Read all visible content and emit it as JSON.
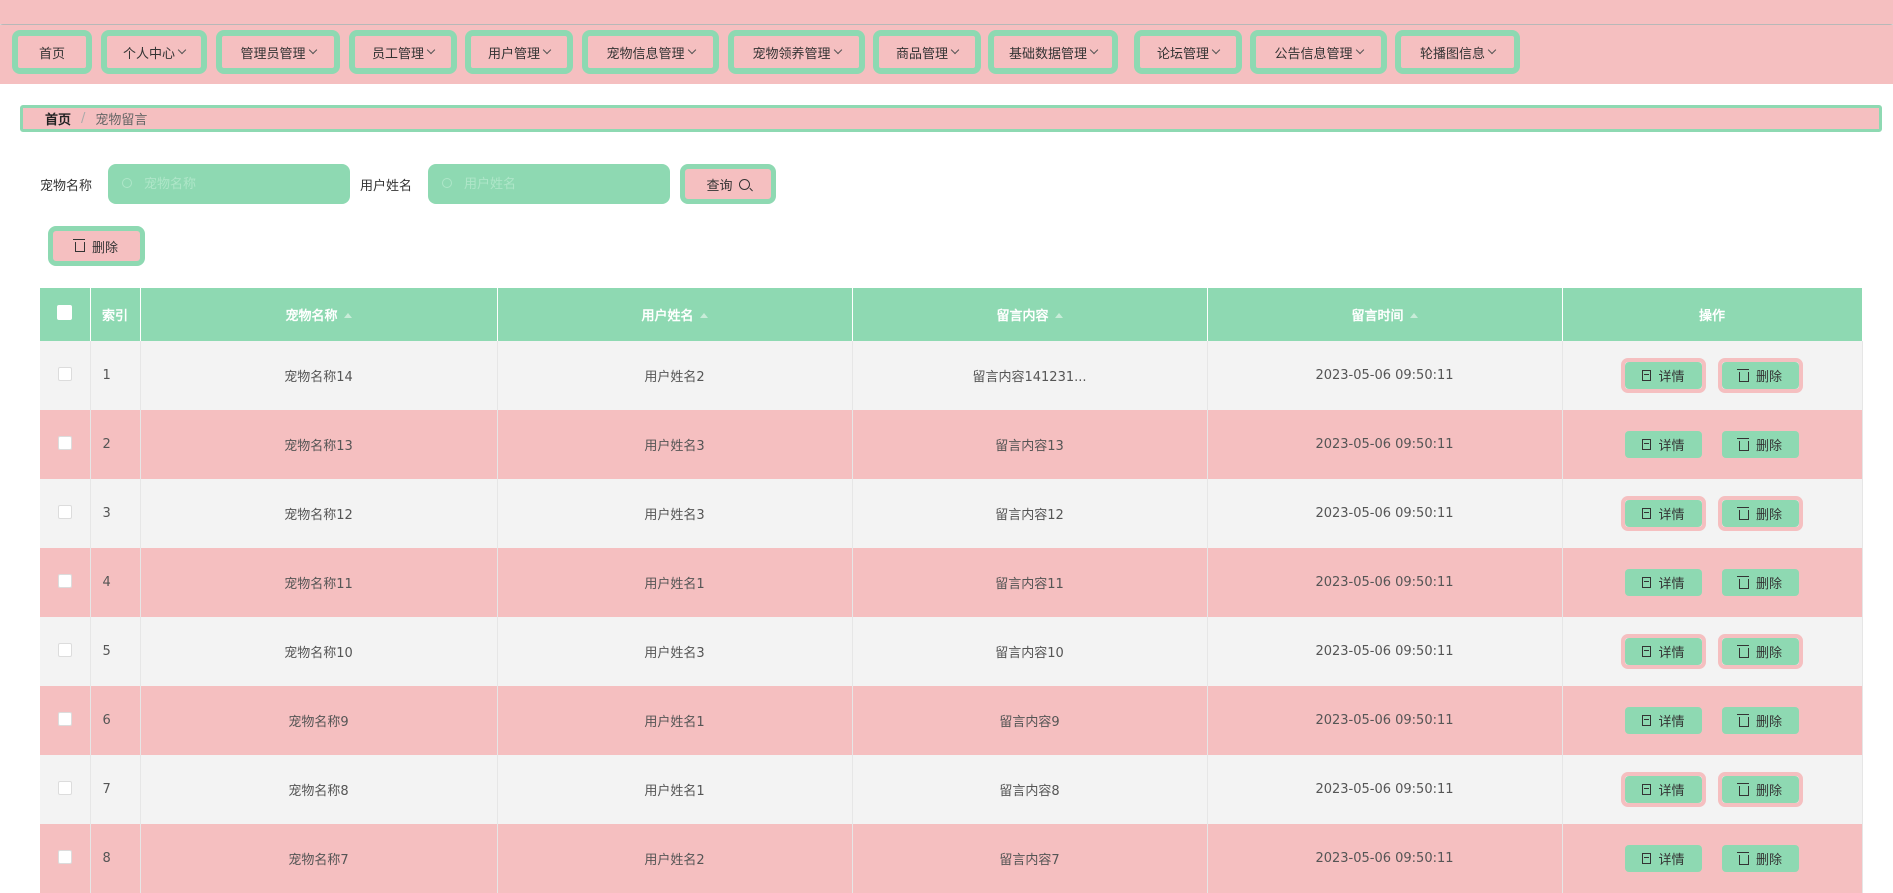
{
  "nav": {
    "menus": [
      {
        "label": "首页",
        "dropdown": false
      },
      {
        "label": "个人中心",
        "dropdown": true
      },
      {
        "label": "管理员管理",
        "dropdown": true
      },
      {
        "label": "员工管理",
        "dropdown": true
      },
      {
        "label": "用户管理",
        "dropdown": true
      },
      {
        "label": "宠物信息管理",
        "dropdown": true
      },
      {
        "label": "宠物领养管理",
        "dropdown": true
      },
      {
        "label": "商品管理",
        "dropdown": true
      },
      {
        "label": "基础数据管理",
        "dropdown": true
      },
      {
        "label": "论坛管理",
        "dropdown": true
      },
      {
        "label": "公告信息管理",
        "dropdown": true
      },
      {
        "label": "轮播图信息",
        "dropdown": true
      }
    ]
  },
  "breadcrumb": {
    "home": "首页",
    "separator": "/",
    "current": "宠物留言"
  },
  "search": {
    "pet_name_label": "宠物名称",
    "pet_name_placeholder": "宠物名称",
    "user_name_label": "用户姓名",
    "user_name_placeholder": "用户姓名",
    "query_label": "查询"
  },
  "toolbar": {
    "delete_label": "删除"
  },
  "table": {
    "columns": {
      "index": "索引",
      "pet_name": "宠物名称",
      "user_name": "用户姓名",
      "content": "留言内容",
      "time": "留言时间",
      "actions": "操作"
    },
    "detail_label": "详情",
    "delete_label": "删除",
    "rows": [
      {
        "index": "1",
        "pet_name": "宠物名称14",
        "user_name": "用户姓名2",
        "content": "留言内容141231...",
        "time": "2023-05-06 09:50:11"
      },
      {
        "index": "2",
        "pet_name": "宠物名称13",
        "user_name": "用户姓名3",
        "content": "留言内容13",
        "time": "2023-05-06 09:50:11"
      },
      {
        "index": "3",
        "pet_name": "宠物名称12",
        "user_name": "用户姓名3",
        "content": "留言内容12",
        "time": "2023-05-06 09:50:11"
      },
      {
        "index": "4",
        "pet_name": "宠物名称11",
        "user_name": "用户姓名1",
        "content": "留言内容11",
        "time": "2023-05-06 09:50:11"
      },
      {
        "index": "5",
        "pet_name": "宠物名称10",
        "user_name": "用户姓名3",
        "content": "留言内容10",
        "time": "2023-05-06 09:50:11"
      },
      {
        "index": "6",
        "pet_name": "宠物名称9",
        "user_name": "用户姓名1",
        "content": "留言内容9",
        "time": "2023-05-06 09:50:11"
      },
      {
        "index": "7",
        "pet_name": "宠物名称8",
        "user_name": "用户姓名1",
        "content": "留言内容8",
        "time": "2023-05-06 09:50:11"
      },
      {
        "index": "8",
        "pet_name": "宠物名称7",
        "user_name": "用户姓名2",
        "content": "留言内容7",
        "time": "2023-05-06 09:50:11"
      }
    ]
  },
  "colors": {
    "pink": "#f5bfc0",
    "green": "#8ed9b2"
  }
}
